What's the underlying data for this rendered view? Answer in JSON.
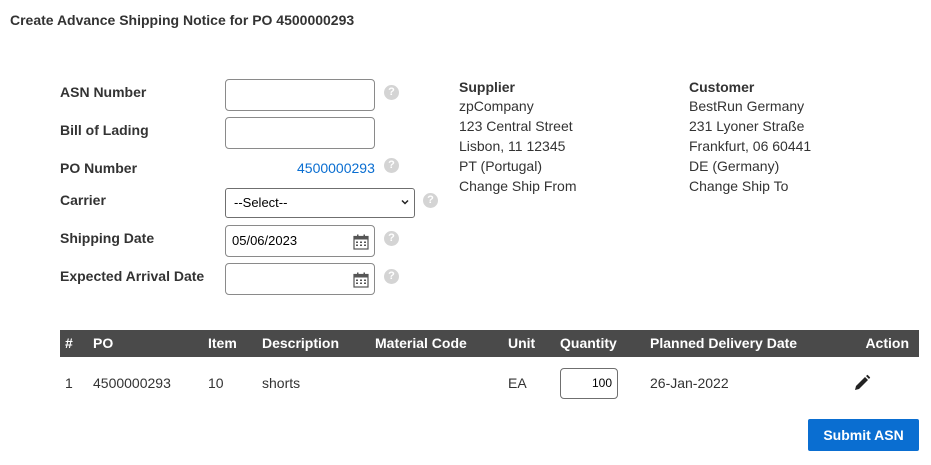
{
  "page": {
    "title": "Create Advance Shipping Notice for PO 4500000293"
  },
  "form": {
    "asn_number_label": "ASN Number",
    "asn_number_value": "",
    "bill_of_lading_label": "Bill of Lading",
    "bill_of_lading_value": "",
    "po_number_label": "PO Number",
    "po_number_value": "4500000293",
    "carrier_label": "Carrier",
    "carrier_selected": "--Select--",
    "shipping_date_label": "Shipping Date",
    "shipping_date_value": "05/06/2023",
    "expected_arrival_label": "Expected Arrival Date",
    "expected_arrival_value": "",
    "help_glyph": "?"
  },
  "supplier": {
    "heading": "Supplier",
    "name": "zpCompany",
    "street": "123 Central Street",
    "city": "Lisbon, 11 12345",
    "country": "PT (Portugal)",
    "change_link": "Change Ship From"
  },
  "customer": {
    "heading": "Customer",
    "name": "BestRun Germany",
    "street": "231 Lyoner Straße",
    "city": "Frankfurt, 06 60441",
    "country": "DE (Germany)",
    "change_link": "Change Ship To"
  },
  "table": {
    "columns": [
      "#",
      "PO",
      "Item",
      "Description",
      "Material Code",
      "Unit",
      "Quantity",
      "Planned Delivery Date",
      "Action"
    ],
    "rows": [
      {
        "num": "1",
        "po": "4500000293",
        "item": "10",
        "description": "shorts",
        "material_code": "",
        "unit": "EA",
        "quantity": "100",
        "planned_delivery_date": "26-Jan-2022",
        "action_icon": "pencil-icon"
      }
    ]
  },
  "actions": {
    "submit_label": "Submit ASN"
  },
  "colors": {
    "accent": "#0a6ed1",
    "table_header": "#4a4a4a",
    "help_icon": "#d4d4d4"
  }
}
